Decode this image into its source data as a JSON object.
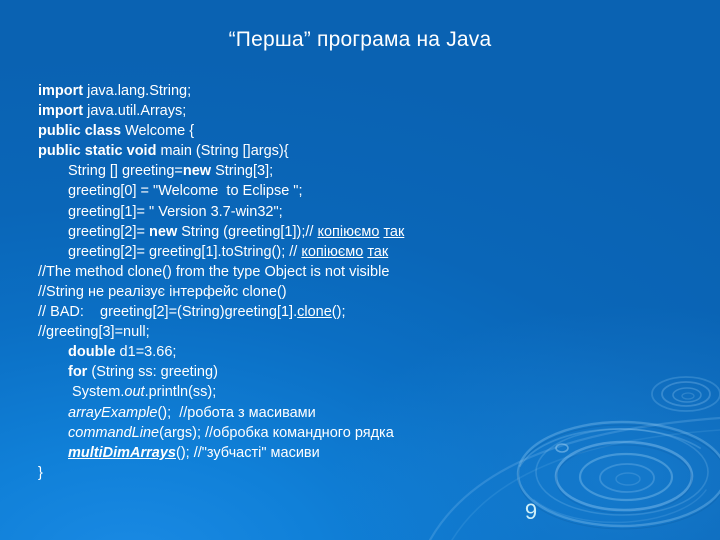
{
  "slide": {
    "title": "“Перша” програма на Java",
    "number": "9",
    "theme": {
      "background_top": "#0b68b8",
      "background_bottom_left": "#1a8ae4",
      "text_color": "#ffffff",
      "slide_number_color": "#cfeff8"
    }
  },
  "code": {
    "lines": [
      {
        "id": "line-1-import-string",
        "indent": 0,
        "text": "import java.lang.String;",
        "parts": [
          {
            "t": "import",
            "style": "bold"
          },
          {
            "t": " java.lang.String;",
            "style": "plain"
          }
        ]
      },
      {
        "id": "line-2-import-arrays",
        "indent": 0,
        "text": "import java.util.Arrays;",
        "parts": [
          {
            "t": "import",
            "style": "bold"
          },
          {
            "t": " java.util.Arrays;",
            "style": "plain"
          }
        ]
      },
      {
        "id": "line-3-class-welcome",
        "indent": 0,
        "text": "public class Welcome {",
        "parts": [
          {
            "t": "public class",
            "style": "bold"
          },
          {
            "t": " Welcome {",
            "style": "plain"
          }
        ]
      },
      {
        "id": "line-4-main-method",
        "indent": 0,
        "text": "public static void main (String []args){",
        "parts": [
          {
            "t": "public static void",
            "style": "bold"
          },
          {
            "t": " main (String []args){",
            "style": "plain"
          }
        ]
      },
      {
        "id": "line-5-greeting-array",
        "indent": 1,
        "text": "String [] greeting=new String[3];",
        "parts": [
          {
            "t": "String [] greeting=",
            "style": "plain"
          },
          {
            "t": "new",
            "style": "bold"
          },
          {
            "t": " String[3];",
            "style": "plain"
          }
        ]
      },
      {
        "id": "line-6-greeting-0",
        "indent": 1,
        "text": "greeting[0] = \"Welcome  to Eclipse \";",
        "parts": [
          {
            "t": "greeting[0] = \"Welcome  to Eclipse \";",
            "style": "plain"
          }
        ]
      },
      {
        "id": "line-7-greeting-1",
        "indent": 1,
        "text": "greeting[1]= \" Version 3.7-win32\";",
        "parts": [
          {
            "t": "greeting[1]= \" Version 3.7-win32\";",
            "style": "plain"
          }
        ]
      },
      {
        "id": "line-8-greeting-2-new",
        "indent": 1,
        "text": "greeting[2]= new String (greeting[1]);// копіюємо так",
        "parts": [
          {
            "t": "greeting[2]= ",
            "style": "plain"
          },
          {
            "t": "new",
            "style": "bold"
          },
          {
            "t": " String (greeting[1]);// ",
            "style": "plain"
          },
          {
            "t": "копіюємо",
            "style": "underline"
          },
          {
            "t": " ",
            "style": "plain"
          },
          {
            "t": "так",
            "style": "underline"
          }
        ]
      },
      {
        "id": "line-9-greeting-2-tostring",
        "indent": 1,
        "text": "greeting[2]= greeting[1].toString(); // копіюємо так",
        "parts": [
          {
            "t": "greeting[2]= greeting[1].toString(); // ",
            "style": "plain"
          },
          {
            "t": "копіюємо",
            "style": "underline"
          },
          {
            "t": " ",
            "style": "plain"
          },
          {
            "t": "так",
            "style": "underline"
          }
        ]
      },
      {
        "id": "line-10-comment-clone-not-visible",
        "indent": 0,
        "text": "//The method clone() from the type Object is not visible",
        "parts": [
          {
            "t": "//The method clone() from the type Object is not visible",
            "style": "plain"
          }
        ]
      },
      {
        "id": "line-11-comment-string-interface",
        "indent": 0,
        "text": "//String не реалізує інтерфейс clone()",
        "parts": [
          {
            "t": "//String не реалізує інтерфейс clone()",
            "style": "plain"
          }
        ]
      },
      {
        "id": "line-12-comment-bad",
        "indent": 0,
        "text": "// BAD:    greeting[2]=(String)greeting[1].clone();",
        "parts": [
          {
            "t": "// BAD:    greeting[2]=(String)greeting[1].",
            "style": "plain"
          },
          {
            "t": "clone",
            "style": "underline"
          },
          {
            "t": "();",
            "style": "plain"
          }
        ]
      },
      {
        "id": "line-13-comment-greeting-3-null",
        "indent": 0,
        "text": "//greeting[3]=null;",
        "parts": [
          {
            "t": "//greeting[3]=null;",
            "style": "plain"
          }
        ]
      },
      {
        "id": "line-14-double-d1",
        "indent": 1,
        "text": "double d1=3.66;",
        "parts": [
          {
            "t": "double",
            "style": "bold"
          },
          {
            "t": " d1=3.66;",
            "style": "plain"
          }
        ]
      },
      {
        "id": "line-15-for-loop",
        "indent": 1,
        "text": "for (String ss: greeting)",
        "parts": [
          {
            "t": "for",
            "style": "bold"
          },
          {
            "t": " (String ss: greeting)",
            "style": "plain"
          }
        ]
      },
      {
        "id": "line-16-println",
        "indent": 1,
        "text": " System.out.println(ss);",
        "parts": [
          {
            "t": " System.",
            "style": "plain"
          },
          {
            "t": "out",
            "style": "italic"
          },
          {
            "t": ".println(ss);",
            "style": "plain"
          }
        ]
      },
      {
        "id": "line-17-array-example",
        "indent": 1,
        "text": "arrayExample();  //робота з масивами",
        "parts": [
          {
            "t": "arrayExample",
            "style": "italic"
          },
          {
            "t": "();  //робота з масивами",
            "style": "plain"
          }
        ]
      },
      {
        "id": "line-18-command-line",
        "indent": 1,
        "text": "commandLine(args); //обробка командного рядка",
        "parts": [
          {
            "t": "commandLine",
            "style": "italic"
          },
          {
            "t": "(args); //обробка командного рядка",
            "style": "plain"
          }
        ]
      },
      {
        "id": "line-19-multi-dim-arrays",
        "indent": 1,
        "text": "multiDimArrays(); //\"зубчасті\" масиви",
        "parts": [
          {
            "t": "multiDimArrays",
            "style": "bold-italic-underline"
          },
          {
            "t": "(); //\"зубчасті\" масиви",
            "style": "plain"
          }
        ]
      },
      {
        "id": "line-20-closing-brace",
        "indent": 0,
        "text": "}",
        "parts": [
          {
            "t": "}",
            "style": "plain"
          }
        ]
      }
    ]
  }
}
